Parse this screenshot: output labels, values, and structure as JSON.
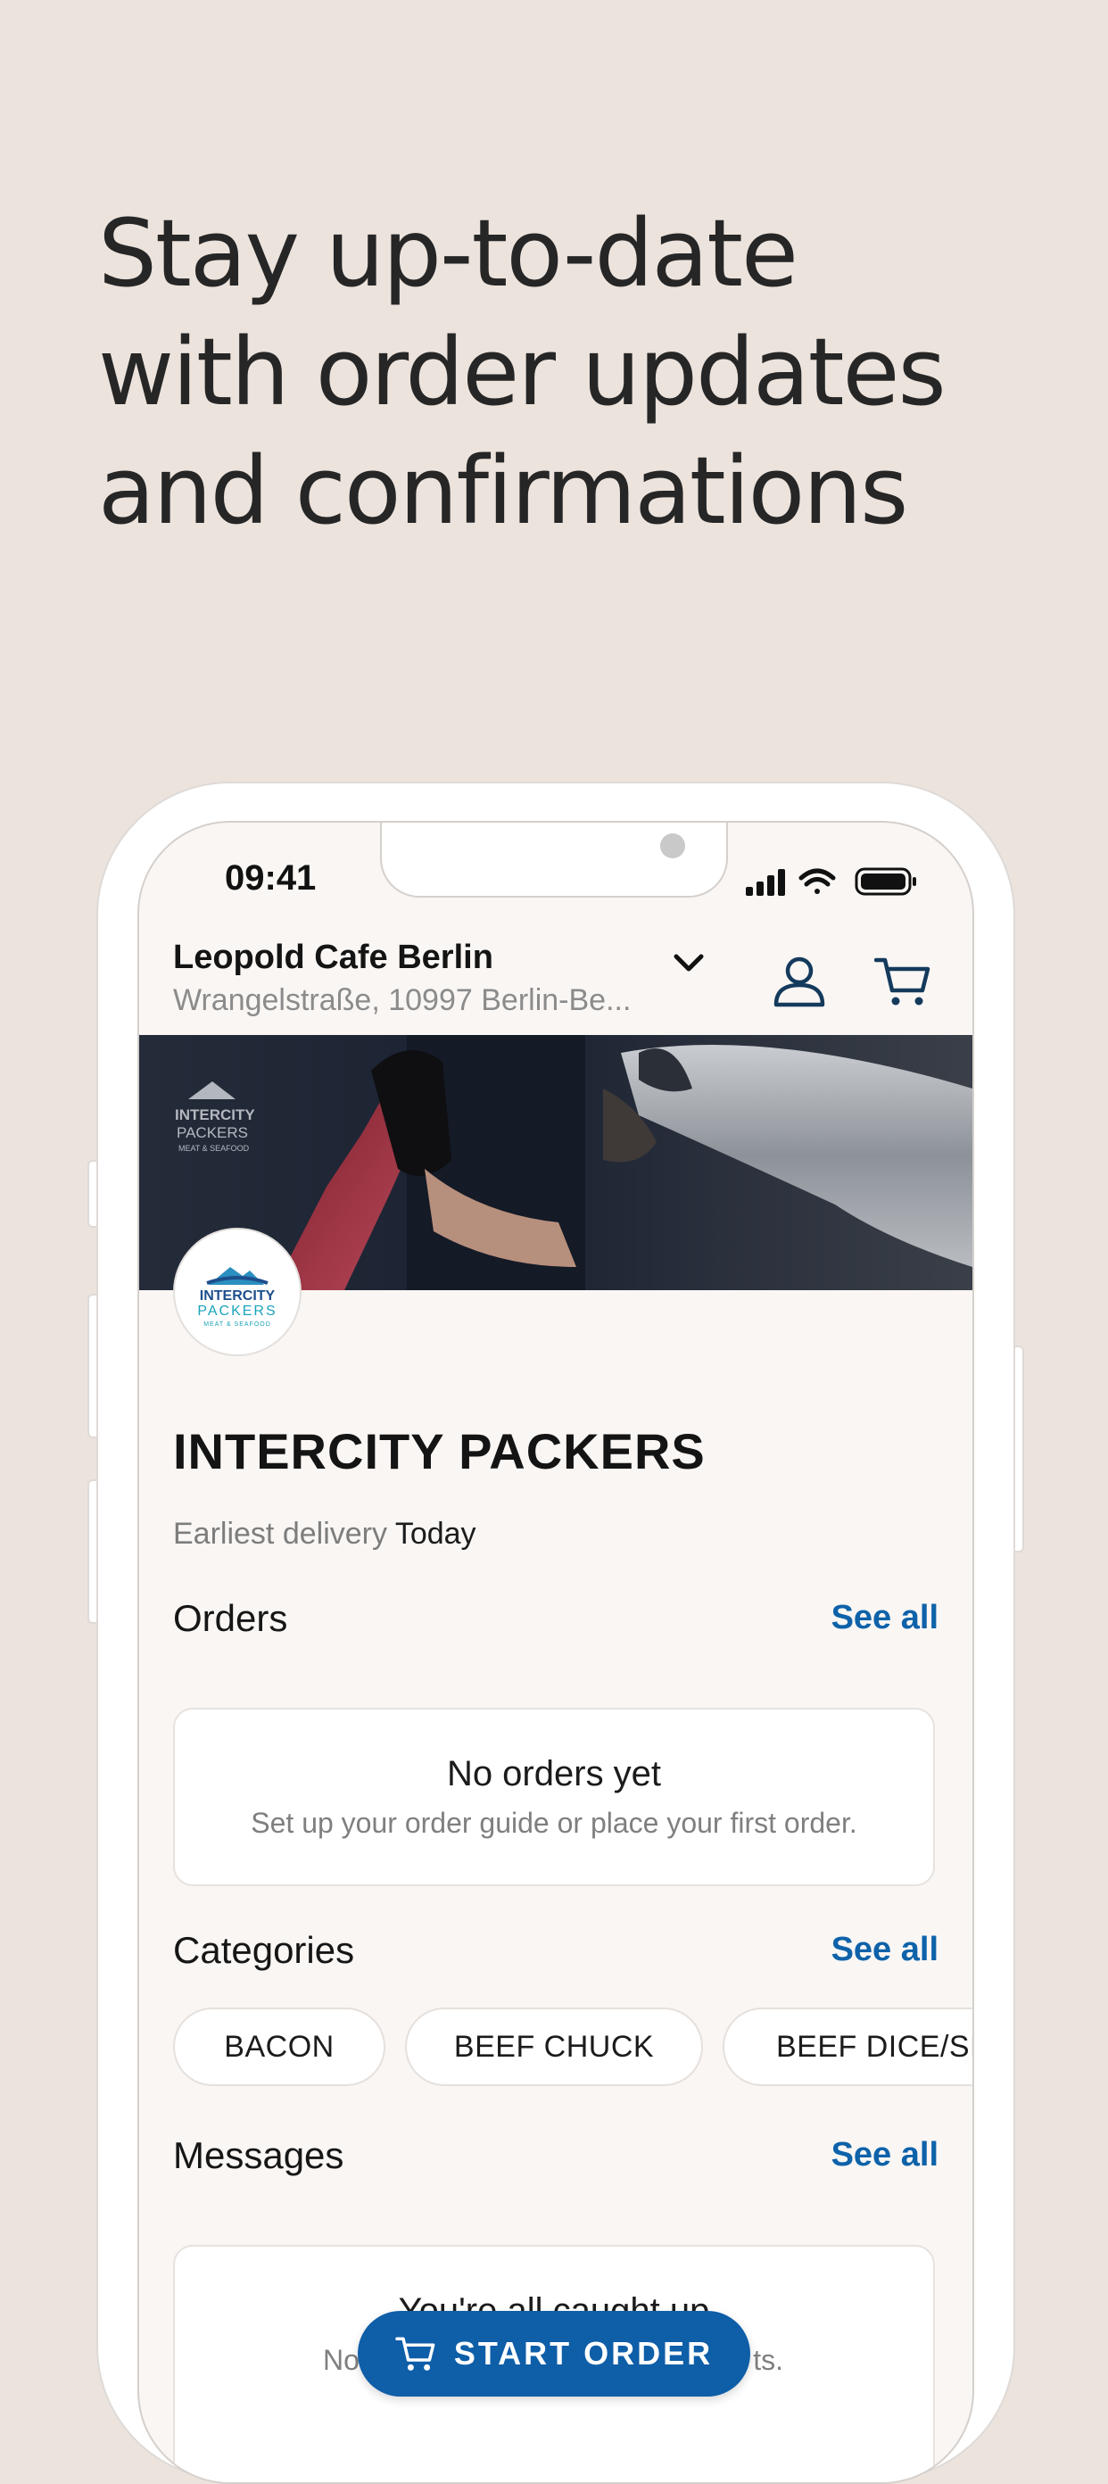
{
  "headline": [
    "Stay up-to-date",
    "with order updates",
    "and confirmations"
  ],
  "status_bar": {
    "time": "09:41"
  },
  "header": {
    "store_name": "Leopold Cafe Berlin",
    "store_address": "Wrangelstraße, 10997 Berlin-Be..."
  },
  "banner": {
    "logo_text": [
      "INTERCITY",
      "PACKERS",
      "MEAT & SEAFOOD"
    ]
  },
  "vendor": {
    "name": "INTERCITY PACKERS",
    "delivery_label": "Earliest delivery",
    "delivery_value": "Today"
  },
  "orders": {
    "title": "Orders",
    "see_all": "See all",
    "empty_title": "No orders yet",
    "empty_subtitle": "Set up your order guide or place your first order."
  },
  "categories": {
    "title": "Categories",
    "see_all": "See all",
    "items": [
      "BACON",
      "BEEF CHUCK",
      "BEEF DICE/SL"
    ]
  },
  "messages": {
    "title": "Messages",
    "see_all": "See all",
    "empty_title": "You're all caught up",
    "empty_subtitle_start": "No",
    "empty_subtitle_end": "ts."
  },
  "cta": {
    "label": "START ORDER"
  },
  "colors": {
    "background": "#ece3dd",
    "accent": "#0f5ea8",
    "screen": "#f9f6f4"
  }
}
